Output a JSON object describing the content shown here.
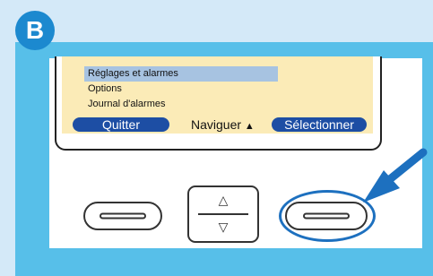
{
  "badge": "B",
  "menu": {
    "items": [
      "Réglages et alarmes",
      "Options",
      "Journal d'alarmes"
    ],
    "selected_index": 0
  },
  "softkeys": {
    "left": "Quitter",
    "middle": "Naviguer",
    "right": "Sélectionner"
  },
  "icons": {
    "nav": "up-down-arrows-icon",
    "up": "triangle-up-icon",
    "down": "triangle-down-icon",
    "pointer": "arrow-pointer-icon"
  },
  "colors": {
    "page_background": "#d4e9f8",
    "panel": "#57bfe9",
    "badge": "#1c89cf",
    "lcd": "#fbebb7",
    "menu_selection": "#a7c3e1",
    "softkey": "#1d4ea4",
    "highlight": "#1d70bf"
  }
}
